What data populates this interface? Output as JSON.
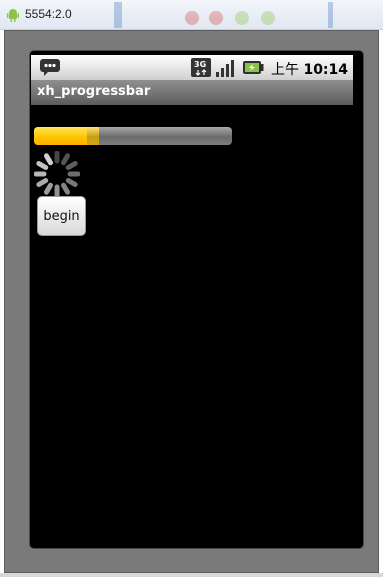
{
  "window": {
    "title": "5554:2.0",
    "icon": "android-icon"
  },
  "statusbar": {
    "notification_icon": "message-icon",
    "network_icon": "3g-icon",
    "signal_icon": "signal-icon",
    "battery_icon": "battery-icon",
    "clock_ampm": "上午",
    "clock_time": "10:14"
  },
  "app": {
    "title": "xh_progressbar",
    "progress": {
      "primary_fraction": 0.27,
      "secondary_fraction": 0.33,
      "primary_color": "#ffc400",
      "secondary_color": "#c79d11"
    },
    "spinner_icon": "loading-spinner-icon",
    "begin_button": "begin"
  },
  "colors": {
    "screen_bg": "#000000",
    "appbar": "#7a7a7a",
    "frame": "#7a7a7a"
  }
}
